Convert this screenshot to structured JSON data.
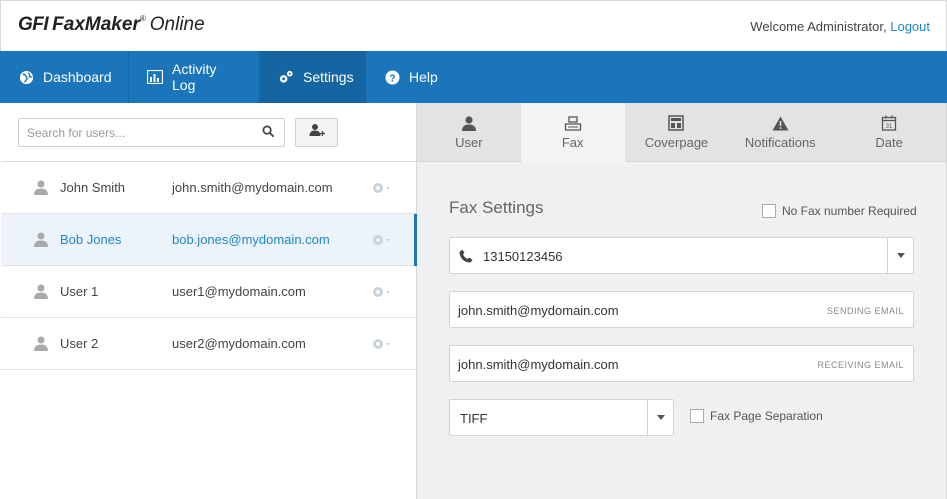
{
  "header": {
    "logo_gfi": "GFI",
    "logo_product": "FaxMaker",
    "logo_suffix": "Online",
    "welcome_text": "Welcome Administrator,",
    "logout_label": "Logout"
  },
  "nav": {
    "items": [
      {
        "label": "Dashboard",
        "icon": "globe-icon"
      },
      {
        "label": "Activity Log",
        "icon": "chart-icon"
      },
      {
        "label": "Settings",
        "icon": "gears-icon",
        "active": true
      },
      {
        "label": "Help",
        "icon": "help-icon"
      }
    ]
  },
  "search": {
    "placeholder": "Search for users..."
  },
  "users": [
    {
      "name": "John Smith",
      "email": "john.smith@mydomain.com"
    },
    {
      "name": "Bob Jones",
      "email": "bob.jones@mydomain.com",
      "selected": true
    },
    {
      "name": "User 1",
      "email": "user1@mydomain.com"
    },
    {
      "name": "User 2",
      "email": "user2@mydomain.com"
    }
  ],
  "tabs": [
    {
      "label": "User",
      "icon": "user-icon"
    },
    {
      "label": "Fax",
      "icon": "printer-icon",
      "active": true
    },
    {
      "label": "Coverpage",
      "icon": "layout-icon"
    },
    {
      "label": "Notifications",
      "icon": "warning-icon"
    },
    {
      "label": "Date",
      "icon": "calendar-icon"
    }
  ],
  "fax_settings": {
    "title": "Fax Settings",
    "no_fax_label": "No Fax number Required",
    "fax_number": "13150123456",
    "sending_email": "john.smith@mydomain.com",
    "sending_email_tag": "SENDING EMAIL",
    "receiving_email": "john.smith@mydomain.com",
    "receiving_email_tag": "RECEIVING EMAIL",
    "format": "TIFF",
    "separation_label": "Fax Page Separation"
  },
  "colors": {
    "nav_bg": "#1b75bb",
    "nav_active": "#1565a3",
    "link": "#1e88c8",
    "selected_row": "#ecf3fa"
  }
}
